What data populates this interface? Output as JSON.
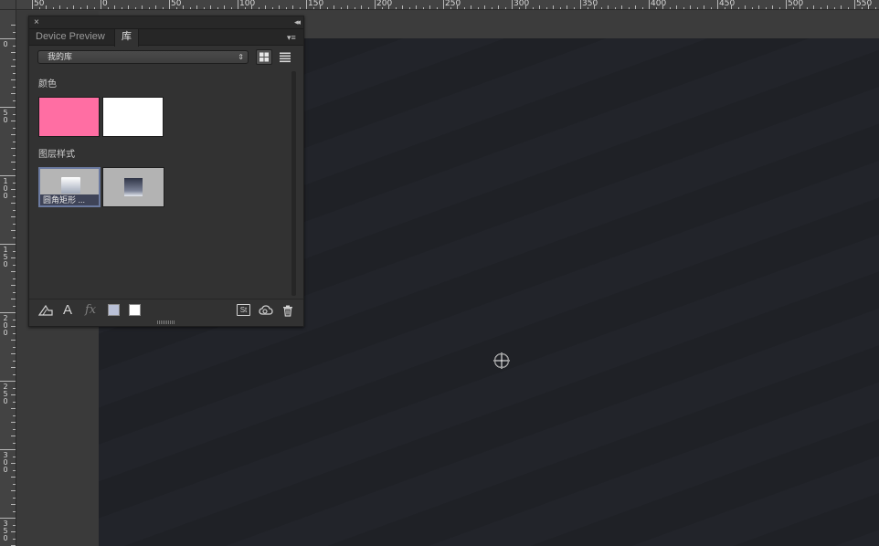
{
  "ruler": {
    "top_labels": [
      "50",
      "0",
      "50",
      "100",
      "150",
      "200",
      "250",
      "300",
      "350",
      "400",
      "450",
      "500",
      "550"
    ],
    "left_labels": [
      "0",
      "50",
      "100",
      "150",
      "200",
      "250",
      "300",
      "350"
    ]
  },
  "panel": {
    "close_glyph": "×",
    "collapse_glyph": "◂◂",
    "tabs": [
      {
        "label": "Device Preview",
        "active": false
      },
      {
        "label": "库",
        "active": true
      }
    ],
    "menu_glyph": "▾≡",
    "library_select": {
      "value": "我的库",
      "arrows": "⇕"
    },
    "views": {
      "grid": "grid-view-icon",
      "list": "list-view-icon"
    },
    "sections": {
      "colors": {
        "label": "颜色",
        "swatches": [
          "#ff6ea3",
          "#ffffff"
        ]
      },
      "layer_styles": {
        "label": "图层样式",
        "items": [
          {
            "label": "圆角矩形 ..."
          },
          {
            "label": ""
          }
        ]
      }
    },
    "footer": {
      "icons": [
        "add-graphic-icon",
        "add-text-icon",
        "add-fx-icon",
        "foreground-color-icon",
        "background-color-icon",
        "stock-icon",
        "creative-cloud-icon",
        "trash-icon"
      ],
      "text_icon": "A",
      "fx_icon": "fx",
      "stock_icon": "St",
      "foreground_color": "#b9c0d6",
      "background_color": "#ffffff"
    }
  },
  "colors": {
    "canvas": "#1f2126",
    "panel_bg": "#323232",
    "selected_border": "#6b7aa0"
  }
}
